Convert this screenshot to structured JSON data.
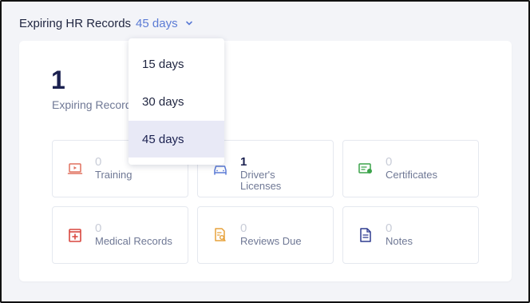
{
  "header": {
    "title": "Expiring HR Records",
    "period": "45 days"
  },
  "summary": {
    "count": "1",
    "label": "Expiring Records"
  },
  "tiles": [
    {
      "count": "0",
      "label": "Training",
      "icon": "laptop-icon",
      "color": "#e0705f"
    },
    {
      "count": "1",
      "label": "Driver's Licenses",
      "icon": "car-icon",
      "color": "#5b7bd5"
    },
    {
      "count": "0",
      "label": "Certificates",
      "icon": "certificate-icon",
      "color": "#3ba34a"
    },
    {
      "count": "0",
      "label": "Medical Records",
      "icon": "medical-kit-icon",
      "color": "#d9473f"
    },
    {
      "count": "0",
      "label": "Reviews Due",
      "icon": "review-document-icon",
      "color": "#e7a23b"
    },
    {
      "count": "0",
      "label": "Notes",
      "icon": "note-document-icon",
      "color": "#2f3b8f"
    }
  ],
  "dropdown": {
    "options": [
      "15 days",
      "30 days",
      "45 days"
    ],
    "selected": "45 days"
  },
  "colors": {
    "accent": "#5b7bd5",
    "selected_bg": "#e8e9f6",
    "text_dark": "#1b2150"
  }
}
